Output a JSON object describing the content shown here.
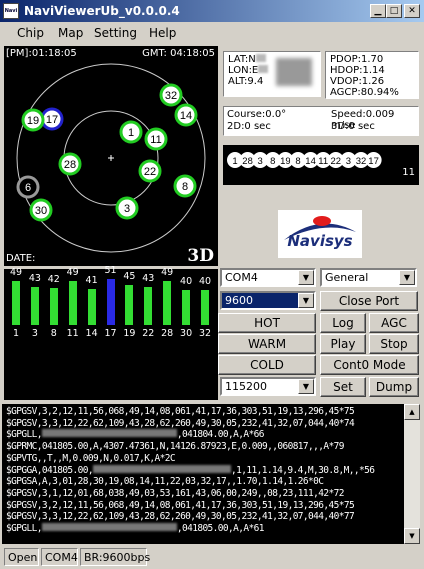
{
  "window": {
    "title": "NaviViewerUb_v0.0.0.4",
    "icon_text": "Navi"
  },
  "menu": [
    "Chip",
    "Map",
    "Setting",
    "Help"
  ],
  "skyview": {
    "local_time": "[PM]:01:18:05",
    "gmt_time": "GMT: 04:18:05",
    "date_label": "DATE:",
    "fix_mode": "3D",
    "satellites": [
      {
        "id": "1",
        "status": "fix"
      },
      {
        "id": "3",
        "status": "fix"
      },
      {
        "id": "6",
        "status": "notrack"
      },
      {
        "id": "8",
        "status": "fix"
      },
      {
        "id": "11",
        "status": "fix"
      },
      {
        "id": "14",
        "status": "fix"
      },
      {
        "id": "17",
        "status": "waas"
      },
      {
        "id": "19",
        "status": "fix"
      },
      {
        "id": "22",
        "status": "fix"
      },
      {
        "id": "28",
        "status": "fix"
      },
      {
        "id": "30",
        "status": "fix"
      },
      {
        "id": "32",
        "status": "fix"
      }
    ]
  },
  "position": {
    "lat": "LAT:N",
    "lon": "LON:E",
    "alt": "ALT:9.4"
  },
  "dop": {
    "pdop": "PDOP:1.70",
    "hdop": "HDOP:1.14",
    "vdop": "VDOP:1.26",
    "agcp": "AGCP:80.94%"
  },
  "motion": {
    "course": "Course:0.0°",
    "speed": "Speed:0.009 m/se",
    "d2": "2D:0 sec",
    "d3": "3D:0 sec"
  },
  "sat_list": {
    "ids": [
      "1",
      "28",
      "3",
      "8",
      "19",
      "8",
      "14",
      "11",
      "22",
      "3",
      "32",
      "17"
    ],
    "count": "11"
  },
  "logo": "Navisys",
  "signal": {
    "chart_data": {
      "type": "bar",
      "categories": [
        "1",
        "3",
        "8",
        "11",
        "14",
        "17",
        "19",
        "22",
        "28",
        "30",
        "32"
      ],
      "values": [
        49,
        43,
        42,
        49,
        41,
        51,
        45,
        43,
        49,
        40,
        40
      ],
      "colors": [
        "#33dd33",
        "#33dd33",
        "#33dd33",
        "#33dd33",
        "#33dd33",
        "#2a2ae6",
        "#33dd33",
        "#33dd33",
        "#33dd33",
        "#33dd33",
        "#33dd33"
      ],
      "ylim": [
        0,
        60
      ]
    }
  },
  "controls": {
    "port": "COM4",
    "mode": "General",
    "baud": "9600",
    "baud2": "115200",
    "close_port": "Close Port",
    "hot": "HOT",
    "warm": "WARM",
    "cold": "COLD",
    "log": "Log",
    "agc": "AGC",
    "play": "Play",
    "stop": "Stop",
    "cont_mode": "Cont0 Mode",
    "set": "Set",
    "dump": "Dump"
  },
  "nmea": [
    "$GPGSV,3,2,12,11,56,068,49,14,08,061,41,17,36,303,51,19,13,296,45*75",
    "$GPGSV,3,3,12,22,62,109,43,28,62,260,49,30,05,232,41,32,07,044,40*74",
    "$GPGLL,",
    ",041804.00,A,A*66",
    "$GPRMC,041805.00,A,4307.47361,N,14126.87923,E,0.009,,060817,,,A*79",
    "$GPVTG,,T,,M,0.009,N,0.017,K,A*2C",
    "$GPGGA,041805.00,",
    ",1,11,1.14,9.4,M,30.8,M,,*56",
    "$GPGSA,A,3,01,28,30,19,08,14,11,22,03,32,17,,1.70,1.14,1.26*0C",
    "$GPGSV,3,1,12,01,68,038,49,03,53,161,43,06,00,249,,08,23,111,42*72",
    "$GPGSV,3,2,12,11,56,068,49,14,08,061,41,17,36,303,51,19,13,296,45*75",
    "$GPGSV,3,3,12,22,62,109,43,28,62,260,49,30,05,232,41,32,07,044,40*77",
    "$GPGLL,",
    ",041805.00,A,A*61"
  ],
  "status": {
    "state": "Open",
    "port": "COM4",
    "baud": "BR:9600bps"
  }
}
